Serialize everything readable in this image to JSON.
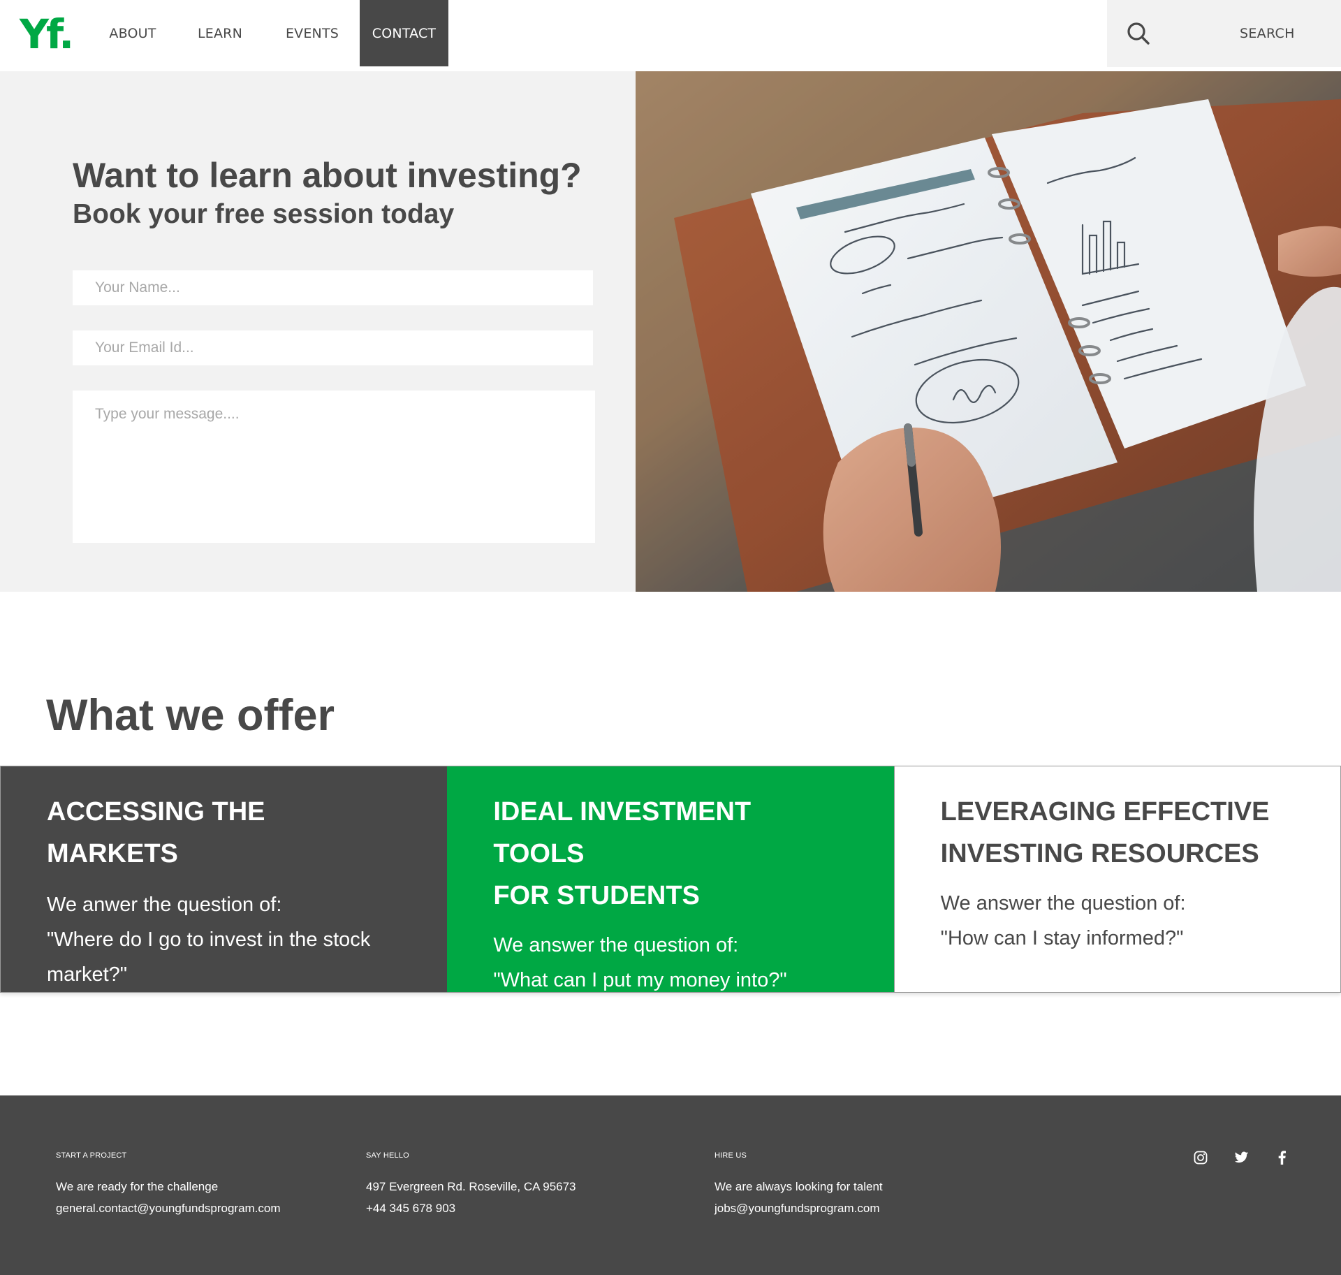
{
  "brand": {
    "logo_text": "Yf",
    "logo_dot": ".",
    "accent_color": "#00a844",
    "dark_color": "#484848"
  },
  "nav": {
    "items": [
      {
        "label": "ABOUT"
      },
      {
        "label": "LEARN"
      },
      {
        "label": "EVENTS"
      },
      {
        "label": "CONTACT",
        "active": true
      }
    ]
  },
  "search": {
    "icon": "search-icon",
    "label": "SEARCH"
  },
  "hero": {
    "title": "Want to learn about investing?",
    "subtitle": "Book your free session today",
    "form": {
      "name_placeholder": "Your Name...",
      "email_placeholder": "Your Email Id...",
      "message_placeholder": "Type your message...."
    },
    "image": {
      "subject": "notebook-planning-photo",
      "notes": [
        "100% responders",
        "5$ each",
        "84% conversation rate",
        "costs : $42,000",
        "= 7,843 / buyer",
        "89%",
        "Upcoming Campaign",
        "Audience Size 15000",
        "Response Rate → 10%",
        "(expect, how?)",
        "Conversion Rate → 5.3%",
        "average buyer purchase → $14,000"
      ]
    }
  },
  "offer": {
    "title": "What we offer",
    "cards": [
      {
        "title": "ACCESSING THE MARKETS",
        "lines": [
          "We anwer the question of:",
          "\"Where do I go to invest in the stock",
          "market?\""
        ]
      },
      {
        "title_lines": [
          "IDEAL INVESTMENT TOOLS",
          "FOR STUDENTS"
        ],
        "lines": [
          "We answer the question of:",
          "\"What can I put my money into?\""
        ]
      },
      {
        "title_lines": [
          "LEVERAGING EFFECTIVE",
          "INVESTING RESOURCES"
        ],
        "lines": [
          "We answer the question of:",
          "\"How can I stay informed?\""
        ]
      }
    ]
  },
  "footer": {
    "columns": [
      {
        "heading": "START A PROJECT",
        "lines": [
          "We are ready for the challenge",
          "general.contact@youngfundsprogram.com"
        ]
      },
      {
        "heading": "SAY HELLO",
        "lines": [
          "497 Evergreen Rd. Roseville, CA 95673",
          "+44 345 678 903"
        ]
      },
      {
        "heading": "HIRE US",
        "lines": [
          "We are always looking for talent",
          "jobs@youngfundsprogram.com"
        ]
      }
    ],
    "socials": [
      "instagram-icon",
      "twitter-icon",
      "facebook-icon"
    ]
  }
}
